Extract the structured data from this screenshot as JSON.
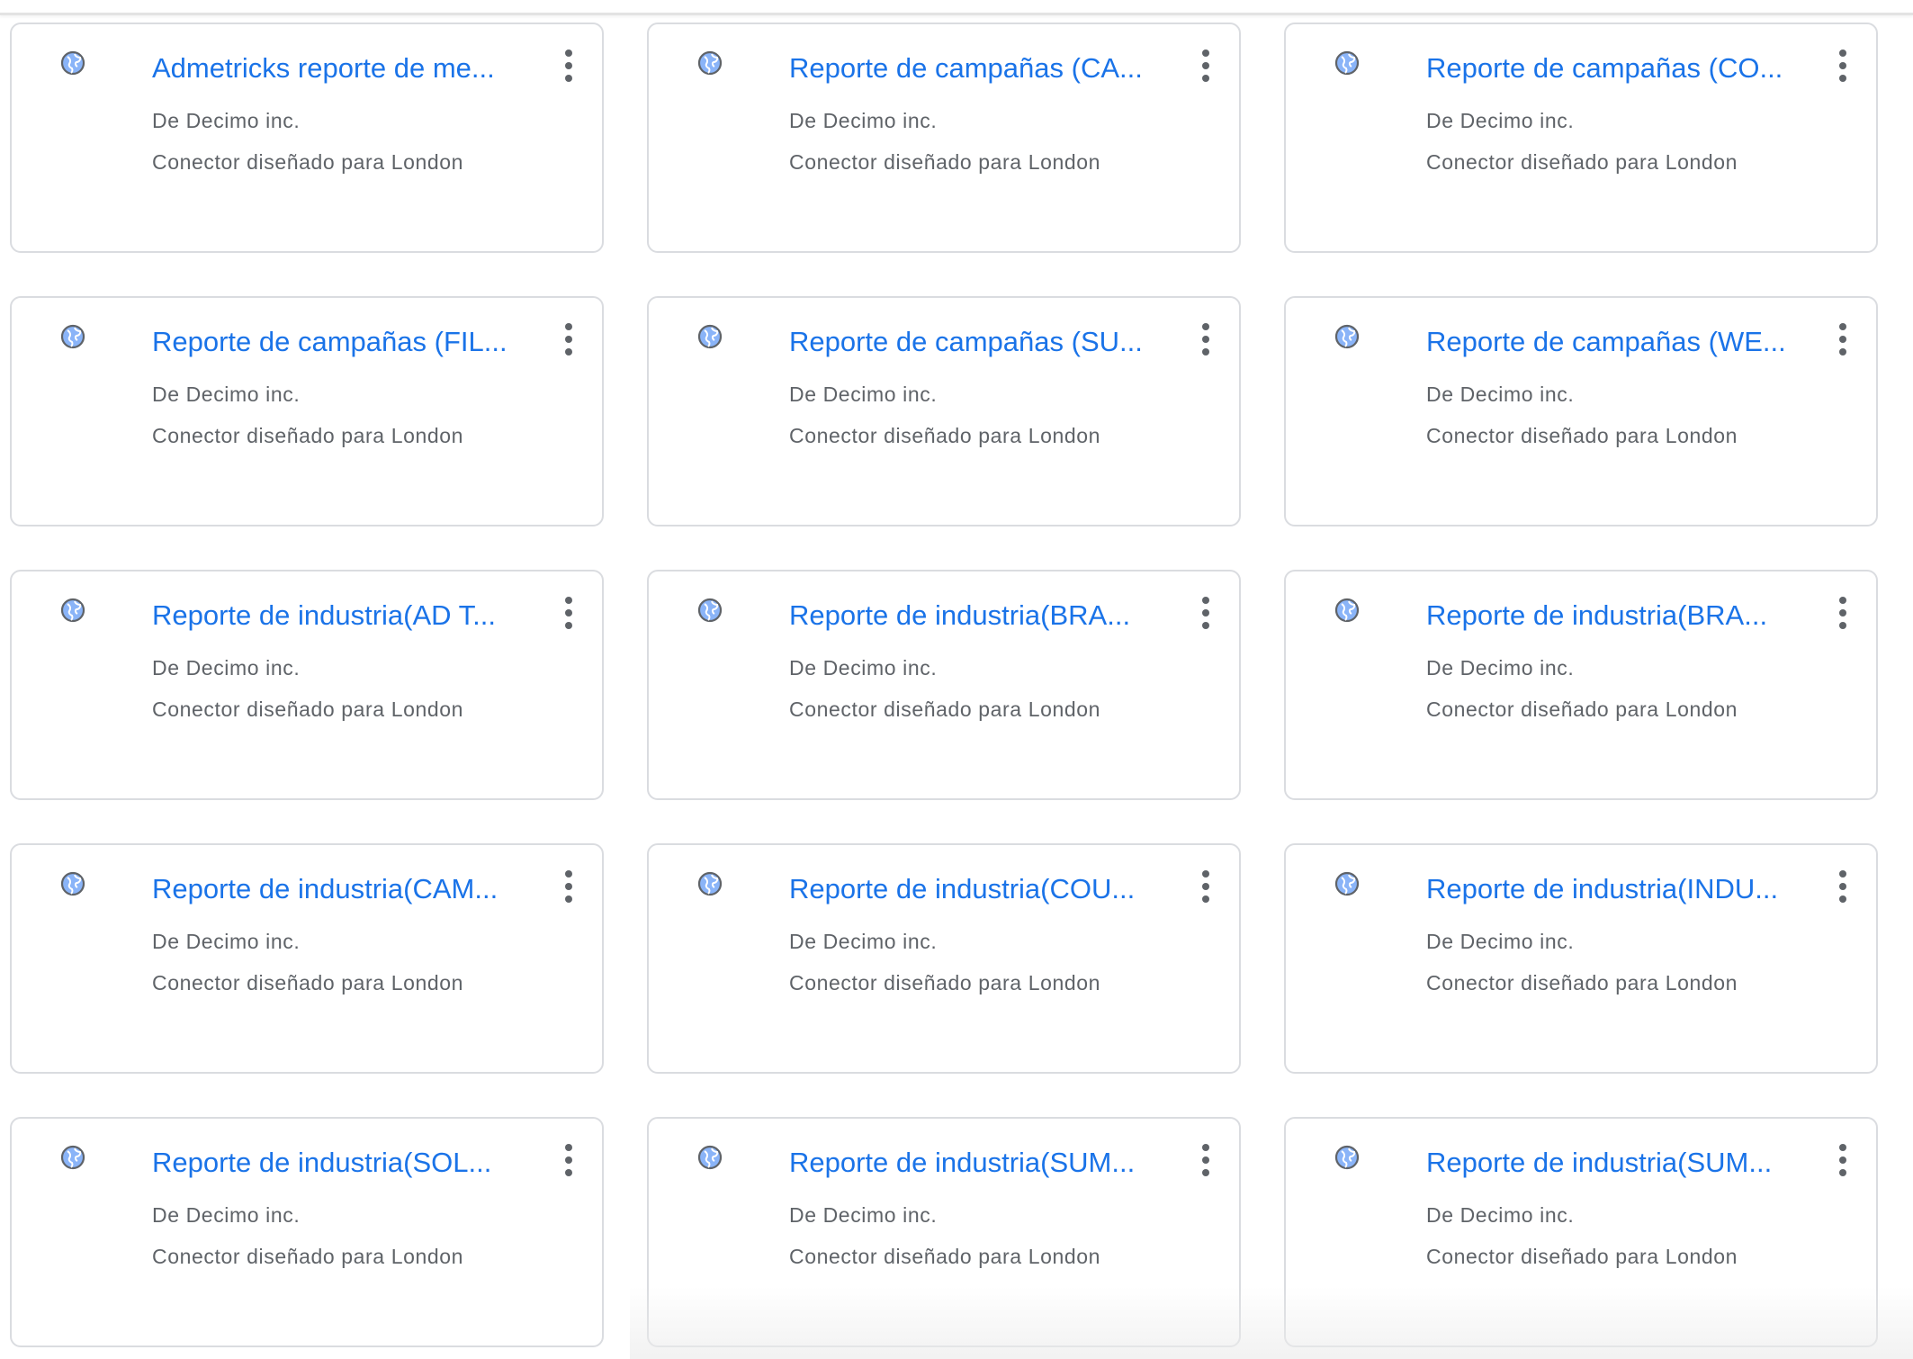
{
  "connectors": [
    {
      "title": "Admetricks reporte de me...",
      "author": "De Decimo inc.",
      "description": "Conector diseñado para London",
      "icon": "globe-icon",
      "menu_icon": "more-vert-icon"
    },
    {
      "title": "Reporte de campañas (CA...",
      "author": "De Decimo inc.",
      "description": "Conector diseñado para London",
      "icon": "globe-icon",
      "menu_icon": "more-vert-icon"
    },
    {
      "title": "Reporte de campañas (CO...",
      "author": "De Decimo inc.",
      "description": "Conector diseñado para London",
      "icon": "globe-icon",
      "menu_icon": "more-vert-icon"
    },
    {
      "title": "Reporte de campañas (FIL...",
      "author": "De Decimo inc.",
      "description": "Conector diseñado para London",
      "icon": "globe-icon",
      "menu_icon": "more-vert-icon"
    },
    {
      "title": "Reporte de campañas (SU...",
      "author": "De Decimo inc.",
      "description": "Conector diseñado para London",
      "icon": "globe-icon",
      "menu_icon": "more-vert-icon"
    },
    {
      "title": "Reporte de campañas (WE...",
      "author": "De Decimo inc.",
      "description": "Conector diseñado para London",
      "icon": "globe-icon",
      "menu_icon": "more-vert-icon"
    },
    {
      "title": "Reporte de industria(AD T...",
      "author": "De Decimo inc.",
      "description": "Conector diseñado para London",
      "icon": "globe-icon",
      "menu_icon": "more-vert-icon"
    },
    {
      "title": "Reporte de industria(BRA...",
      "author": "De Decimo inc.",
      "description": "Conector diseñado para London",
      "icon": "globe-icon",
      "menu_icon": "more-vert-icon"
    },
    {
      "title": "Reporte de industria(BRA...",
      "author": "De Decimo inc.",
      "description": "Conector diseñado para London",
      "icon": "globe-icon",
      "menu_icon": "more-vert-icon"
    },
    {
      "title": "Reporte de industria(CAM...",
      "author": "De Decimo inc.",
      "description": "Conector diseñado para London",
      "icon": "globe-icon",
      "menu_icon": "more-vert-icon"
    },
    {
      "title": "Reporte de industria(COU...",
      "author": "De Decimo inc.",
      "description": "Conector diseñado para London",
      "icon": "globe-icon",
      "menu_icon": "more-vert-icon"
    },
    {
      "title": "Reporte de industria(INDU...",
      "author": "De Decimo inc.",
      "description": "Conector diseñado para London",
      "icon": "globe-icon",
      "menu_icon": "more-vert-icon"
    },
    {
      "title": "Reporte de industria(SOL...",
      "author": "De Decimo inc.",
      "description": "Conector diseñado para London",
      "icon": "globe-icon",
      "menu_icon": "more-vert-icon"
    },
    {
      "title": "Reporte de industria(SUM...",
      "author": "De Decimo inc.",
      "description": "Conector diseñado para London",
      "icon": "globe-icon",
      "menu_icon": "more-vert-icon"
    },
    {
      "title": "Reporte de industria(SUM...",
      "author": "De Decimo inc.",
      "description": "Conector diseñado para London",
      "icon": "globe-icon",
      "menu_icon": "more-vert-icon"
    }
  ],
  "colors": {
    "title": "#1a73e8",
    "secondary_text": "#5f6368",
    "card_border": "#dadce0",
    "icon_gray": "#5f6368",
    "globe_blue": "#8ab4f8"
  }
}
